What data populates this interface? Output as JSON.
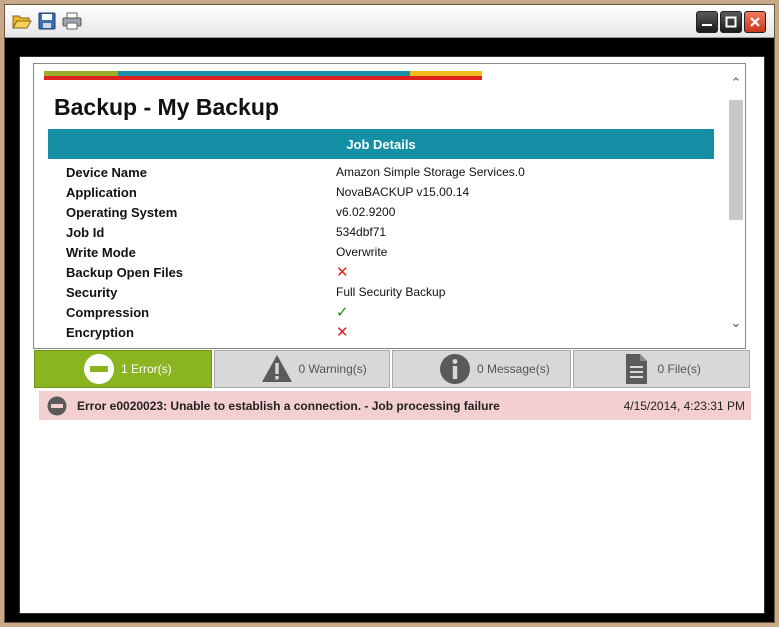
{
  "toolbar": {
    "open_icon": "folder-open-icon",
    "save_icon": "save-icon",
    "print_icon": "print-icon"
  },
  "window_controls": {
    "minimize": "minimize-icon",
    "maximize": "maximize-icon",
    "close": "close-icon"
  },
  "report": {
    "title": "Backup - My Backup",
    "section_header": "Job Details",
    "details": [
      {
        "label": "Device Name",
        "value": "Amazon Simple Storage Services.0"
      },
      {
        "label": "Application",
        "value": "NovaBACKUP v15.00.14"
      },
      {
        "label": "Operating System",
        "value": "v6.02.9200"
      },
      {
        "label": "Job Id",
        "value": "534dbf71"
      },
      {
        "label": "Write Mode",
        "value": "Overwrite"
      },
      {
        "label": "Backup Open Files",
        "value": "✕",
        "state": "no"
      },
      {
        "label": "Security",
        "value": "Full Security Backup"
      },
      {
        "label": "Compression",
        "value": "✓",
        "state": "yes"
      },
      {
        "label": "Encryption",
        "value": "✕",
        "state": "no"
      }
    ]
  },
  "tabs": [
    {
      "label": "1 Error(s)",
      "icon": "error-minus-icon",
      "active": true
    },
    {
      "label": "0 Warning(s)",
      "icon": "warning-triangle-icon",
      "active": false
    },
    {
      "label": "0 Message(s)",
      "icon": "info-icon",
      "active": false
    },
    {
      "label": "0 File(s)",
      "icon": "file-icon",
      "active": false
    }
  ],
  "errors": [
    {
      "icon": "error-minus-icon",
      "message": "Error e0020023: Unable to establish a connection. - Job processing failure",
      "timestamp": "4/15/2014, 4:23:31 PM"
    }
  ],
  "colors": {
    "accent_teal": "#158fa6",
    "active_tab_green": "#8ab521",
    "error_row_pink": "#f3cfd0",
    "no_red": "#e01f1f",
    "yes_green": "#1a8a1a"
  }
}
